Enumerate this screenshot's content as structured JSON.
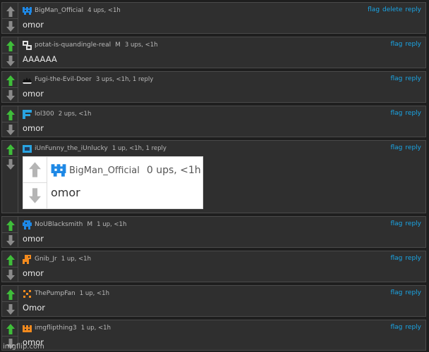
{
  "comments": [
    {
      "username": "BigMan_Official",
      "mod": "",
      "meta": "4 ups, <1h",
      "actions": [
        "flag",
        "delete",
        "reply"
      ],
      "text": "omor",
      "avatar": "blue-pixel-creature-icon"
    },
    {
      "username": "potat-is-quandingle-real",
      "mod": "M",
      "meta": "3 ups, <1h",
      "actions": [
        "flag",
        "reply"
      ],
      "text": "AAAAAA",
      "avatar": "white-pixel-glyph-icon"
    },
    {
      "username": "Fugi-the-Evil-Doer",
      "mod": "",
      "meta": "3 ups, <1h, 1 reply",
      "actions": [
        "flag",
        "reply"
      ],
      "text": "omor",
      "avatar": "black-spiky-blob-icon"
    },
    {
      "username": "lol300",
      "mod": "",
      "meta": "2 ups, <1h",
      "actions": [
        "flag",
        "reply"
      ],
      "text": "omor",
      "avatar": "blue-letter-f-icon"
    },
    {
      "username": "iUnFunny_the_iUnlucky",
      "mod": "",
      "meta": "1 up, <1h, 1 reply",
      "actions": [
        "flag",
        "reply"
      ],
      "text": "",
      "avatar": "blue-square-icon"
    },
    {
      "username": "NoUBlacksmith",
      "mod": "M",
      "meta": "1 up, <1h",
      "actions": [
        "flag",
        "reply"
      ],
      "text": "omor",
      "avatar": "blue-pixel-figure-icon"
    },
    {
      "username": "Gnib_Jr",
      "mod": "",
      "meta": "1 up, <1h",
      "actions": [
        "flag",
        "reply"
      ],
      "text": "omor",
      "avatar": "orange-pixel-creature-icon"
    },
    {
      "username": "ThePumpFan",
      "mod": "",
      "meta": "1 up, <1h",
      "actions": [
        "flag",
        "reply"
      ],
      "text": "Omor",
      "avatar": "orange-x-pattern-icon"
    },
    {
      "username": "imgflipthing3",
      "mod": "",
      "meta": "1 up, <1h",
      "actions": [
        "flag",
        "reply"
      ],
      "text": "omor",
      "avatar": "orange-crown-icon"
    }
  ],
  "embed": {
    "username": "BigMan_Official",
    "meta": "0 ups, <1h",
    "text": "omor"
  },
  "watermark": "imgflip.com",
  "colors": {
    "upvote": "#3fbd3a",
    "downvote": "#8a8a8a",
    "link": "#1aa7e8",
    "background": "#1e1e1e",
    "panel": "#2f2f2f"
  }
}
